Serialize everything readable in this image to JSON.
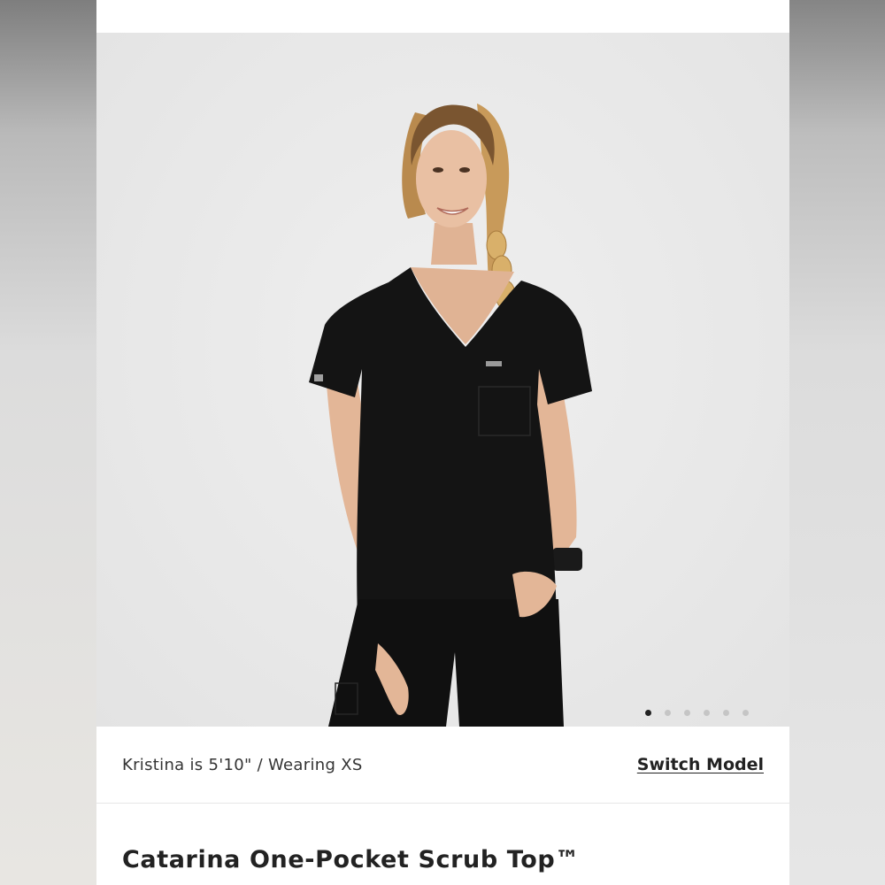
{
  "product": {
    "model_info": "Kristina is 5'10\" / Wearing XS",
    "switch_model_label": "Switch Model",
    "title": "Catarina One-Pocket Scrub Top™"
  },
  "gallery": {
    "total_images": 6,
    "active_index": 0,
    "background": "#e9e9e9",
    "garment_color": "#121212"
  }
}
